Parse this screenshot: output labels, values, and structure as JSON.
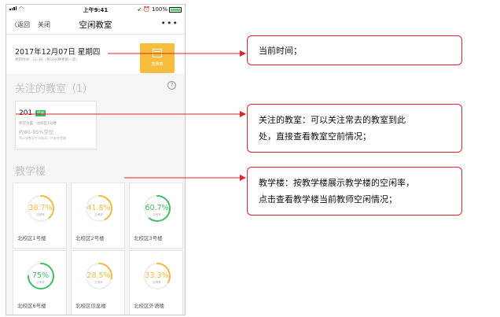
{
  "status_bar": {
    "time": "上午9:41",
    "battery": "100%"
  },
  "nav": {
    "back_label": "返回",
    "close_label": "关闭",
    "title": "空闲教室",
    "more_label": "•••"
  },
  "date_card": {
    "date": "2017年12月07日  星期四",
    "update_note": "更新时间：11:30（每10分钟更新一次）",
    "timetable_label": "按课表"
  },
  "favorites": {
    "title": "关注的教室（1）",
    "room": "201",
    "tag": "空闲",
    "location": "所在位置：北校区1号楼",
    "vacancy": "约80-95%空位",
    "hint": "预计该教室空闲情况，供参考提醒"
  },
  "buildings": {
    "title": "教学楼",
    "ring_label": "空闲率",
    "items": [
      {
        "name": "北校区1号楼",
        "value": "38.7%",
        "rate": 0.387,
        "color": "#f5b942"
      },
      {
        "name": "北校区2号楼",
        "value": "41.8%",
        "rate": 0.418,
        "color": "#f5b942"
      },
      {
        "name": "北校区3号楼",
        "value": "60.7%",
        "rate": 0.607,
        "color": "#3dbf63"
      },
      {
        "name": "北校区6号楼",
        "value": "75%",
        "rate": 0.75,
        "color": "#3dbf63"
      },
      {
        "name": "北校区信息楼",
        "value": "28.5%",
        "rate": 0.285,
        "color": "#f5b942"
      },
      {
        "name": "北校区外语楼",
        "value": "33.3%",
        "rate": 0.333,
        "color": "#f5b942"
      }
    ]
  },
  "callouts": [
    {
      "lines": [
        "当前时间；"
      ]
    },
    {
      "lines": [
        "关注的教室：可以关注常去的教室到此",
        "处，直接查看教室空前情况；"
      ]
    },
    {
      "lines": [
        "教学楼：按教学楼展示教学楼的空闲率，",
        "点击查看教学楼当前教师空闲情况；"
      ]
    }
  ],
  "colors": {
    "accent_red": "#e0232c",
    "orange": "#f7bd3c",
    "green": "#3cb95c"
  }
}
